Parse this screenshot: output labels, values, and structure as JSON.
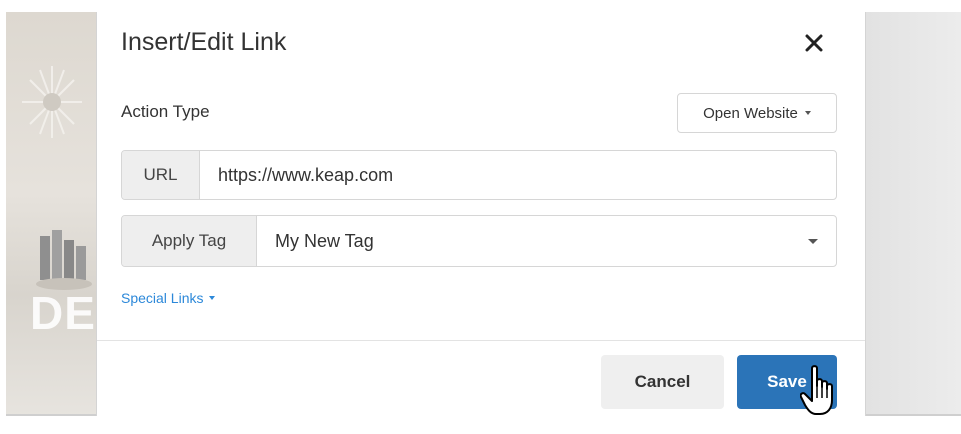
{
  "dialog": {
    "title": "Insert/Edit Link",
    "close_icon": "close-icon"
  },
  "action_type": {
    "label": "Action Type",
    "selected": "Open Website"
  },
  "url": {
    "addon_label": "URL",
    "value": "https://www.keap.com"
  },
  "apply_tag": {
    "addon_label": "Apply Tag",
    "value": "My New Tag"
  },
  "special_links": {
    "label": "Special Links"
  },
  "footer": {
    "cancel_label": "Cancel",
    "save_label": "Save"
  },
  "background": {
    "partial_text": "DER"
  },
  "colors": {
    "link": "#2c88d9",
    "primary_button": "#2b74b8",
    "secondary_button": "#efefef"
  },
  "cursor_icon": "hand-pointer-icon"
}
